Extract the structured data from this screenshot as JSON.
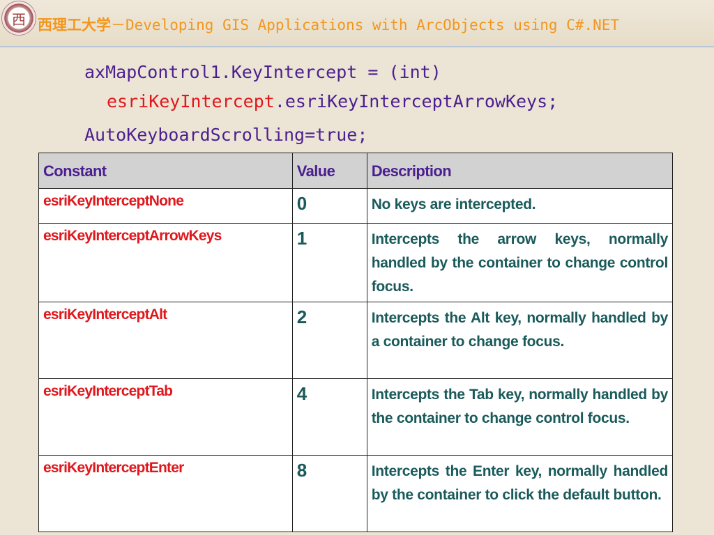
{
  "header": {
    "title_cn": "西理工大学",
    "title_sep": "－",
    "title_en": "Developing GIS Applications with ArcObjects using C#.NET"
  },
  "code": {
    "line1": "axMapControl1.KeyIntercept = (int)",
    "line2_type": "esriKeyIntercept",
    "line2_rest": ".esriKeyInterceptArrowKeys;",
    "line3": "AutoKeyboardScrolling=true;"
  },
  "table": {
    "headers": [
      "Constant",
      "Value",
      "Description"
    ],
    "rows": [
      {
        "constant": "esriKeyInterceptNone",
        "value": "0",
        "description": "No keys are intercepted."
      },
      {
        "constant": "esriKeyInterceptArrowKeys",
        "value": "1",
        "description": "Intercepts the arrow keys, normally handled by the container to change control focus."
      },
      {
        "constant": "esriKeyInterceptAlt",
        "value": "2",
        "description": "Intercepts the Alt key, normally handled by a container to change focus."
      },
      {
        "constant": "esriKeyInterceptTab",
        "value": "4",
        "description": "Intercepts the Tab key, normally handled by the container to change control focus."
      },
      {
        "constant": "esriKeyInterceptEnter",
        "value": "8",
        "description": "Intercepts the Enter key, normally handled by the container to click the default button."
      }
    ]
  },
  "colors": {
    "background": "#ece4d4",
    "title": "#f3961b",
    "code": "#4b1f8f",
    "constant": "#e0171c",
    "value_text": "#1a5a5a",
    "header_fill": "#d2d2d2"
  }
}
